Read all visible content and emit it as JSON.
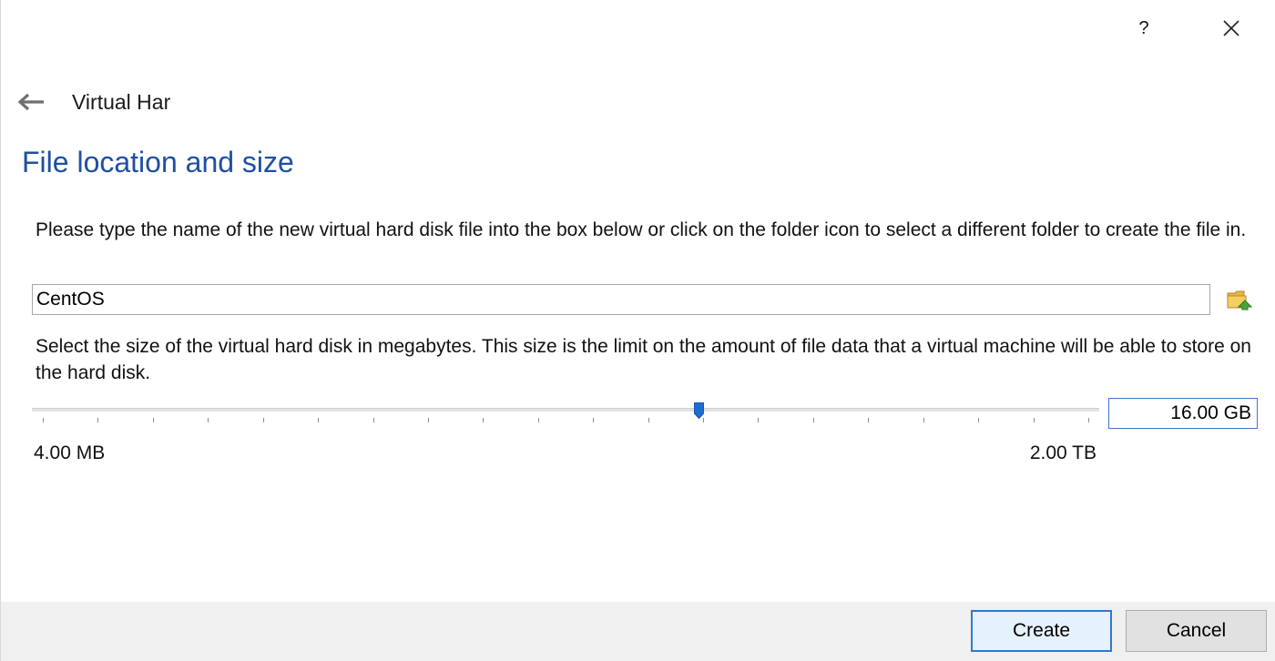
{
  "window": {
    "help_label": "?",
    "close_label": "✕"
  },
  "header": {
    "back_icon": "back-arrow-icon",
    "title": "Virtual Har"
  },
  "page": {
    "heading": "File location and size",
    "file_description": "Please type the name of the new virtual hard disk file into the box below or click on the folder icon to select a different folder to create the file in.",
    "file_name_value": "CentOS",
    "folder_icon": "folder-icon",
    "size_description": "Select the size of the virtual hard disk in megabytes. This size is the limit on the amount of file data that a virtual machine will be able to store on the hard disk.",
    "slider": {
      "min_label": "4.00 MB",
      "max_label": "2.00 TB",
      "position_fraction": 0.627,
      "tick_count": 20
    },
    "size_value": "16.00 GB"
  },
  "footer": {
    "create_label": "Create",
    "cancel_label": "Cancel"
  },
  "colors": {
    "heading": "#1f4fa3",
    "accent": "#2f79d0",
    "slider_handle": "#1c6fd1"
  }
}
